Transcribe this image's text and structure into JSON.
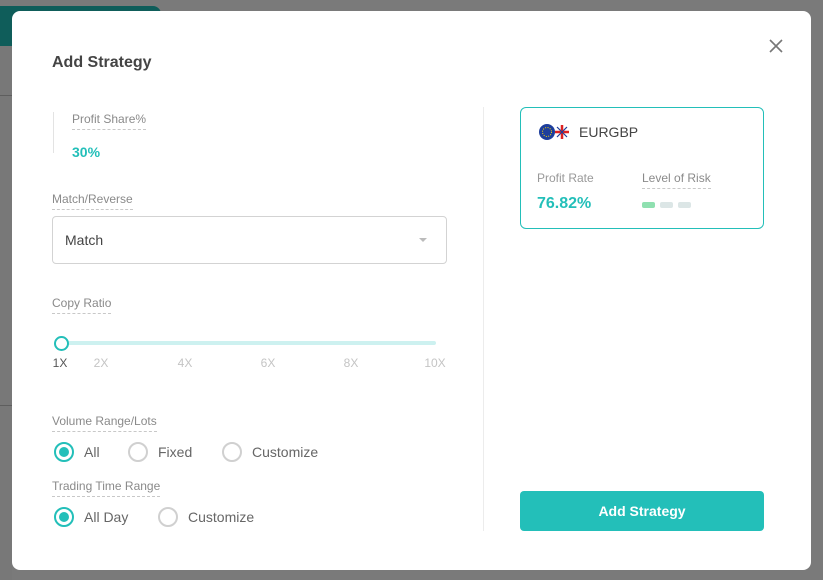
{
  "modal": {
    "title": "Add Strategy",
    "close_icon": "close-icon",
    "profit_share": {
      "label": "Profit Share%",
      "value": "30%"
    },
    "match_reverse": {
      "label": "Match/Reverse",
      "selected": "Match"
    },
    "copy_ratio": {
      "label": "Copy Ratio",
      "ticks": [
        "1X",
        "2X",
        "4X",
        "6X",
        "8X",
        "10X"
      ],
      "value": "1X"
    },
    "volume_range": {
      "label": "Volume Range/Lots",
      "options": [
        "All",
        "Fixed",
        "Customize"
      ],
      "selected": "All"
    },
    "trading_time": {
      "label": "Trading Time Range",
      "options": [
        "All Day",
        "Customize"
      ],
      "selected": "All Day"
    },
    "card": {
      "symbol": "EURGBP",
      "profit_rate_label": "Profit Rate",
      "profit_rate": "76.82%",
      "risk_label": "Level of Risk",
      "risk_level": 1,
      "risk_max": 3
    },
    "submit_label": "Add Strategy"
  },
  "colors": {
    "accent": "#23bfb9",
    "risk_active": "#8fe0b0",
    "risk_inactive": "#dce6e6"
  }
}
